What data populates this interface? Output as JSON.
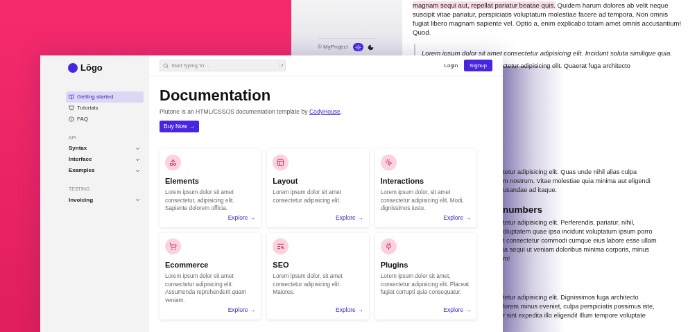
{
  "back_sidebar": {
    "copyright": "© MyProject",
    "theme_options": [
      {
        "kind": "light",
        "selected": true
      },
      {
        "kind": "dark",
        "selected": false
      }
    ]
  },
  "back_article": {
    "paragraph_highlight": "magnam sequi aut, repellat pariatur beatae quis.",
    "paragraph_rest": " Quidem harum dolores ab velit neque suscipit vitae pariatur, perspiciatis voluptatum molestiae facere ad tempora. Non omnis fugiat libero magnam sapiente vel. Optio a, enim explicabo totam amet omnis accusantium! Quod.",
    "quote": "Lorem ipsum dolor sit amet consectetur adipisicing elit. Incidunt soluta similique quia.",
    "visible_blocks": [
      {
        "kind": "text",
        "lines": [
          "ctetur adipisicing elit. Quaerat fuga architecto"
        ]
      },
      {
        "kind": "text",
        "lines": [
          "tetur adipisicing elit. Quas unde nihil alias culpa",
          "m nostrum. Vitae molestiae quia minima aut eligendi",
          "usandae ad itaque."
        ]
      },
      {
        "kind": "heading",
        "lines": [
          "numbers"
        ]
      },
      {
        "kind": "text",
        "lines": [
          "tetur adipisicing elit. Perferendis, pariatur, nihil,",
          "oluptatem quae ipsa incidunt voluptatum ipsum porro",
          "t consectetur commodi cumque eius labore esse ullam",
          "ia sequi ut veniam doloribus minima corporis, minus",
          "m!"
        ]
      },
      {
        "kind": "text",
        "lines": [
          "tetur adipisicing elit. Dignissimos fuga architecto",
          "lorem minus eveniet, culpa perspiciatis possimus iste,",
          "r sint expedita illo eligendi! Illum tempore voluptate"
        ]
      }
    ]
  },
  "front": {
    "logo": "Lōgo",
    "sidebar": {
      "items": [
        {
          "label": "Getting started",
          "selected": true
        },
        {
          "label": "Tutorials",
          "selected": false
        },
        {
          "label": "FAQ",
          "selected": false
        }
      ],
      "sections": [
        {
          "title": "API",
          "items": [
            {
              "label": "Syntax",
              "expanded": false
            },
            {
              "label": "Interface",
              "expanded": false
            },
            {
              "label": "Examples",
              "expanded": false
            }
          ]
        },
        {
          "title": "TESTING",
          "items": [
            {
              "label": "Invoicing",
              "expanded": false
            }
          ]
        }
      ]
    },
    "search": {
      "placeholder": "Start typing 'in'...",
      "shortcut": "/"
    },
    "login": "Login",
    "signup": "Signup",
    "title": "Documentation",
    "intro": "Plutone is an HTML/CSS/JS documentation template by ",
    "intro_link": "CodyHouse",
    "intro_end": ".",
    "buy_button": "Buy Now →",
    "cards": [
      {
        "title": "Elements",
        "text": "Lorem ipsum dolor sit amet consectetur, adipisicing elit. Sapiente dolorem officia.",
        "link": "Explore →"
      },
      {
        "title": "Layout",
        "text": "Lorem ipsum dolor sit amet consectetur adipisicing elit.",
        "link": "Explore →"
      },
      {
        "title": "Interactions",
        "text": "Lorem ipsum dolor, sit amet consectetur adipisicing elit. Modi, dignissimos iusto.",
        "link": "Explore →"
      },
      {
        "title": "Ecommerce",
        "text": "Lorem ipsum dolor sit amet consectetur adipisicing elit. Assumenda reprehenderit quam veniam.",
        "link": "Explore →"
      },
      {
        "title": "SEO",
        "text": "Lorem ipsum dolor, sit amet consectetur adipisicing elit. Maiores.",
        "link": "Explore →"
      },
      {
        "title": "Plugins",
        "text": "Lorem ipsum dolor sit amet, consectetur adipisicing elit. Placeat fugiat corrupti quia consequatur.",
        "link": "Explore →"
      }
    ]
  }
}
